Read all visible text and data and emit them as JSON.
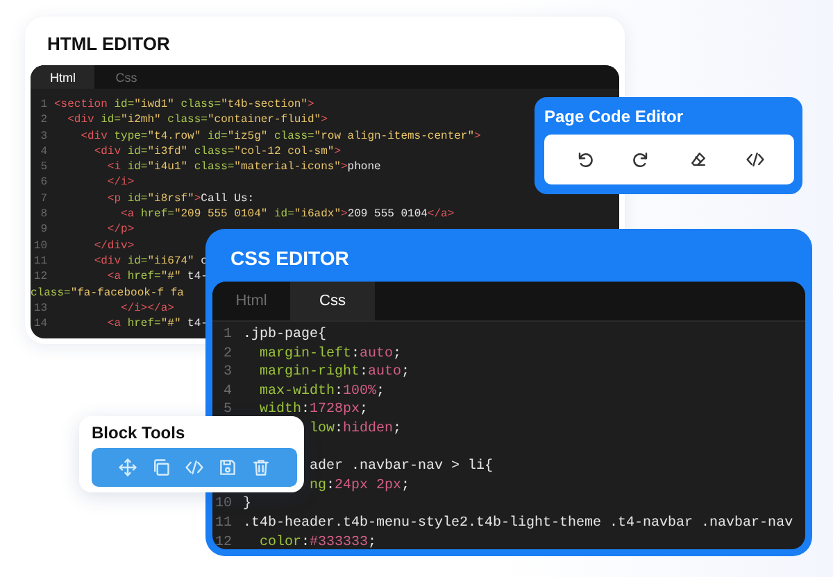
{
  "html_editor": {
    "title": "HTML EDITOR",
    "tabs": [
      {
        "label": "Html",
        "selected": true
      },
      {
        "label": "Css",
        "selected": false
      }
    ],
    "lines": [
      {
        "kind": "line",
        "number": "1",
        "text": "<section id=\"iwd1\" class=\"t4b-section\">"
      },
      {
        "kind": "line",
        "number": "2",
        "text": "  <div id=\"i2mh\" class=\"container-fluid\">"
      },
      {
        "kind": "line",
        "number": "3",
        "text": "    <div type=\"t4.row\" id=\"iz5g\" class=\"row align-items-center\">"
      },
      {
        "kind": "line",
        "number": "4",
        "text": "      <div id=\"i3fd\" class=\"col-12 col-sm\">"
      },
      {
        "kind": "line",
        "number": "5",
        "text": "        <i id=\"i4u1\" class=\"material-icons\">phone"
      },
      {
        "kind": "line",
        "number": "6",
        "text": "        </i>"
      },
      {
        "kind": "line",
        "number": "7",
        "text": "        <p id=\"i8rsf\">Call Us:"
      },
      {
        "kind": "line",
        "number": "8",
        "text": "          <a href=\"209 555 0104\" id=\"i6adx\">209 555 0104</a>"
      },
      {
        "kind": "line",
        "number": "9",
        "text": "        </p>"
      },
      {
        "kind": "line",
        "number": "10",
        "text": "      </div>"
      },
      {
        "kind": "line",
        "number": "11",
        "text": "      <div id=\"ii674\" c"
      },
      {
        "kind": "line",
        "number": "12",
        "text": "        <a href=\"#\" t4-"
      },
      {
        "kind": "wrap",
        "text": "class=\"fa-facebook-f fa"
      },
      {
        "kind": "line",
        "number": "13",
        "text": "          </i></a>"
      },
      {
        "kind": "line",
        "number": "14",
        "text": "        <a href=\"#\" t4-"
      }
    ]
  },
  "page_code_editor": {
    "title": "Page Code Editor",
    "tools": [
      {
        "kind": "undo"
      },
      {
        "kind": "redo"
      },
      {
        "kind": "eraser"
      },
      {
        "kind": "code"
      }
    ]
  },
  "css_editor": {
    "title": "CSS EDITOR",
    "tabs": [
      {
        "label": "Html",
        "selected": false
      },
      {
        "label": "Css",
        "selected": true
      }
    ],
    "lines": [
      {
        "kind": "line",
        "number": "1",
        "text": ".jpb-page{"
      },
      {
        "kind": "line",
        "number": "2",
        "text": "  margin-left:auto;"
      },
      {
        "kind": "line",
        "number": "3",
        "text": "  margin-right:auto;"
      },
      {
        "kind": "line",
        "number": "4",
        "text": "  max-width:100%;"
      },
      {
        "kind": "line",
        "number": "5",
        "text": "  width:1728px;"
      },
      {
        "kind": "covered",
        "text": "low:hidden;"
      },
      {
        "kind": "hidden"
      },
      {
        "kind": "covered",
        "text": "ader .navbar-nav > li{"
      },
      {
        "kind": "covered",
        "text": "ng:24px 2px;"
      },
      {
        "kind": "line",
        "number": "10",
        "text": "}"
      },
      {
        "kind": "line",
        "number": "11",
        "text": ".t4b-header.t4b-menu-style2.t4b-light-theme .t4-navbar .navbar-nav"
      },
      {
        "kind": "line",
        "number": "12",
        "text": "  color:#333333;"
      }
    ]
  },
  "block_tools": {
    "title": "Block Tools",
    "tools": [
      {
        "kind": "move"
      },
      {
        "kind": "copy"
      },
      {
        "kind": "code"
      },
      {
        "kind": "save"
      },
      {
        "kind": "trash"
      }
    ]
  }
}
